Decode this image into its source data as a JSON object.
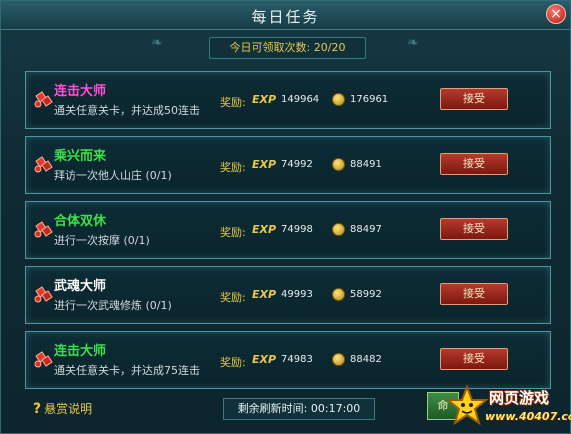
{
  "window": {
    "title": "每日任务",
    "close_label": "×"
  },
  "quota": {
    "text": "今日可领取次数: 20/20"
  },
  "reward_label": "奖励:",
  "exp_label": "EXP",
  "accept_label": "接受",
  "tasks": [
    {
      "name": "连击大师",
      "name_color": "#ff4fd8",
      "desc": "通关任意关卡，并达成50连击",
      "exp": "149964",
      "coins": "176961"
    },
    {
      "name": "乘兴而来",
      "name_color": "#3ee04a",
      "desc": "拜访一次他人山庄 (0/1)",
      "exp": "74992",
      "coins": "88491"
    },
    {
      "name": "合体双休",
      "name_color": "#3ee04a",
      "desc": "进行一次按摩 (0/1)",
      "exp": "74998",
      "coins": "88497"
    },
    {
      "name": "武魂大师",
      "name_color": "#ffffff",
      "desc": "进行一次武魂修炼 (0/1)",
      "exp": "49993",
      "coins": "58992"
    },
    {
      "name": "连击大师",
      "name_color": "#3ee04a",
      "desc": "通关任意关卡，并达成75连击",
      "exp": "74983",
      "coins": "88482"
    }
  ],
  "footer": {
    "help_label": "悬赏说明",
    "refresh_text": "剩余刷新时间: 00:17:00",
    "corner_button_label": "命"
  },
  "watermark": {
    "text": "网页游戏",
    "url": "www.40407.com"
  },
  "icons": {
    "task_icon": "red-gem-icon",
    "coin_icon": "gold-coin-icon",
    "help_icon": "question-mark-icon"
  }
}
